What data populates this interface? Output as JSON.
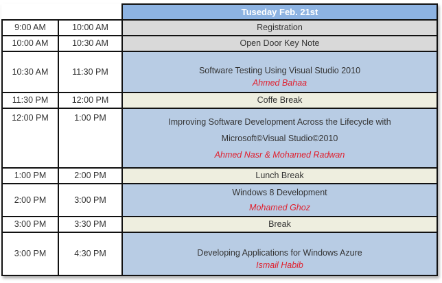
{
  "header": {
    "day": "Tuseday Feb. 21st"
  },
  "colors": {
    "header": "#8db3e2",
    "plenary": "#d9d9d9",
    "session": "#b8cce4",
    "break": "#eeeedf",
    "speaker": "#e0202e"
  },
  "rows": [
    {
      "start": "9:00 AM",
      "end": "10:00 AM",
      "kind": "plenary",
      "title": [
        "Registration"
      ],
      "speaker": ""
    },
    {
      "start": "10:00 AM",
      "end": "10:30 AM",
      "kind": "plenary",
      "title": [
        "Open Door Key Note"
      ],
      "speaker": ""
    },
    {
      "start": "10:30 AM",
      "end": "11:30 PM",
      "kind": "session",
      "title": [
        "Software Testing Using Visual Studio 2010"
      ],
      "speaker": "Ahmed Bahaa"
    },
    {
      "start": "11:30 PM",
      "end": "12:00 PM",
      "kind": "break",
      "title": [
        "Coffe Break"
      ],
      "speaker": ""
    },
    {
      "start": "12:00 PM",
      "end": "1:00 PM",
      "kind": "session",
      "title": [
        "Improving Software Development Across the Lifecycle with",
        "Microsoft©Visual Studio©2010"
      ],
      "speaker": "Ahmed Nasr & Mohamed Radwan"
    },
    {
      "start": "1:00 PM",
      "end": "2:00 PM",
      "kind": "break",
      "title": [
        "Lunch Break"
      ],
      "speaker": ""
    },
    {
      "start": "2:00 PM",
      "end": "3:00 PM",
      "kind": "session",
      "title": [
        "Windows 8 Development"
      ],
      "speaker": "Mohamed Ghoz"
    },
    {
      "start": "3:00 PM",
      "end": "3:30 PM",
      "kind": "break",
      "title": [
        "Break"
      ],
      "speaker": ""
    },
    {
      "start": "3:00 PM",
      "end": "4:30 PM",
      "kind": "session",
      "title": [
        "Developing Applications for Windows Azure"
      ],
      "speaker": "Ismail Habib"
    }
  ]
}
